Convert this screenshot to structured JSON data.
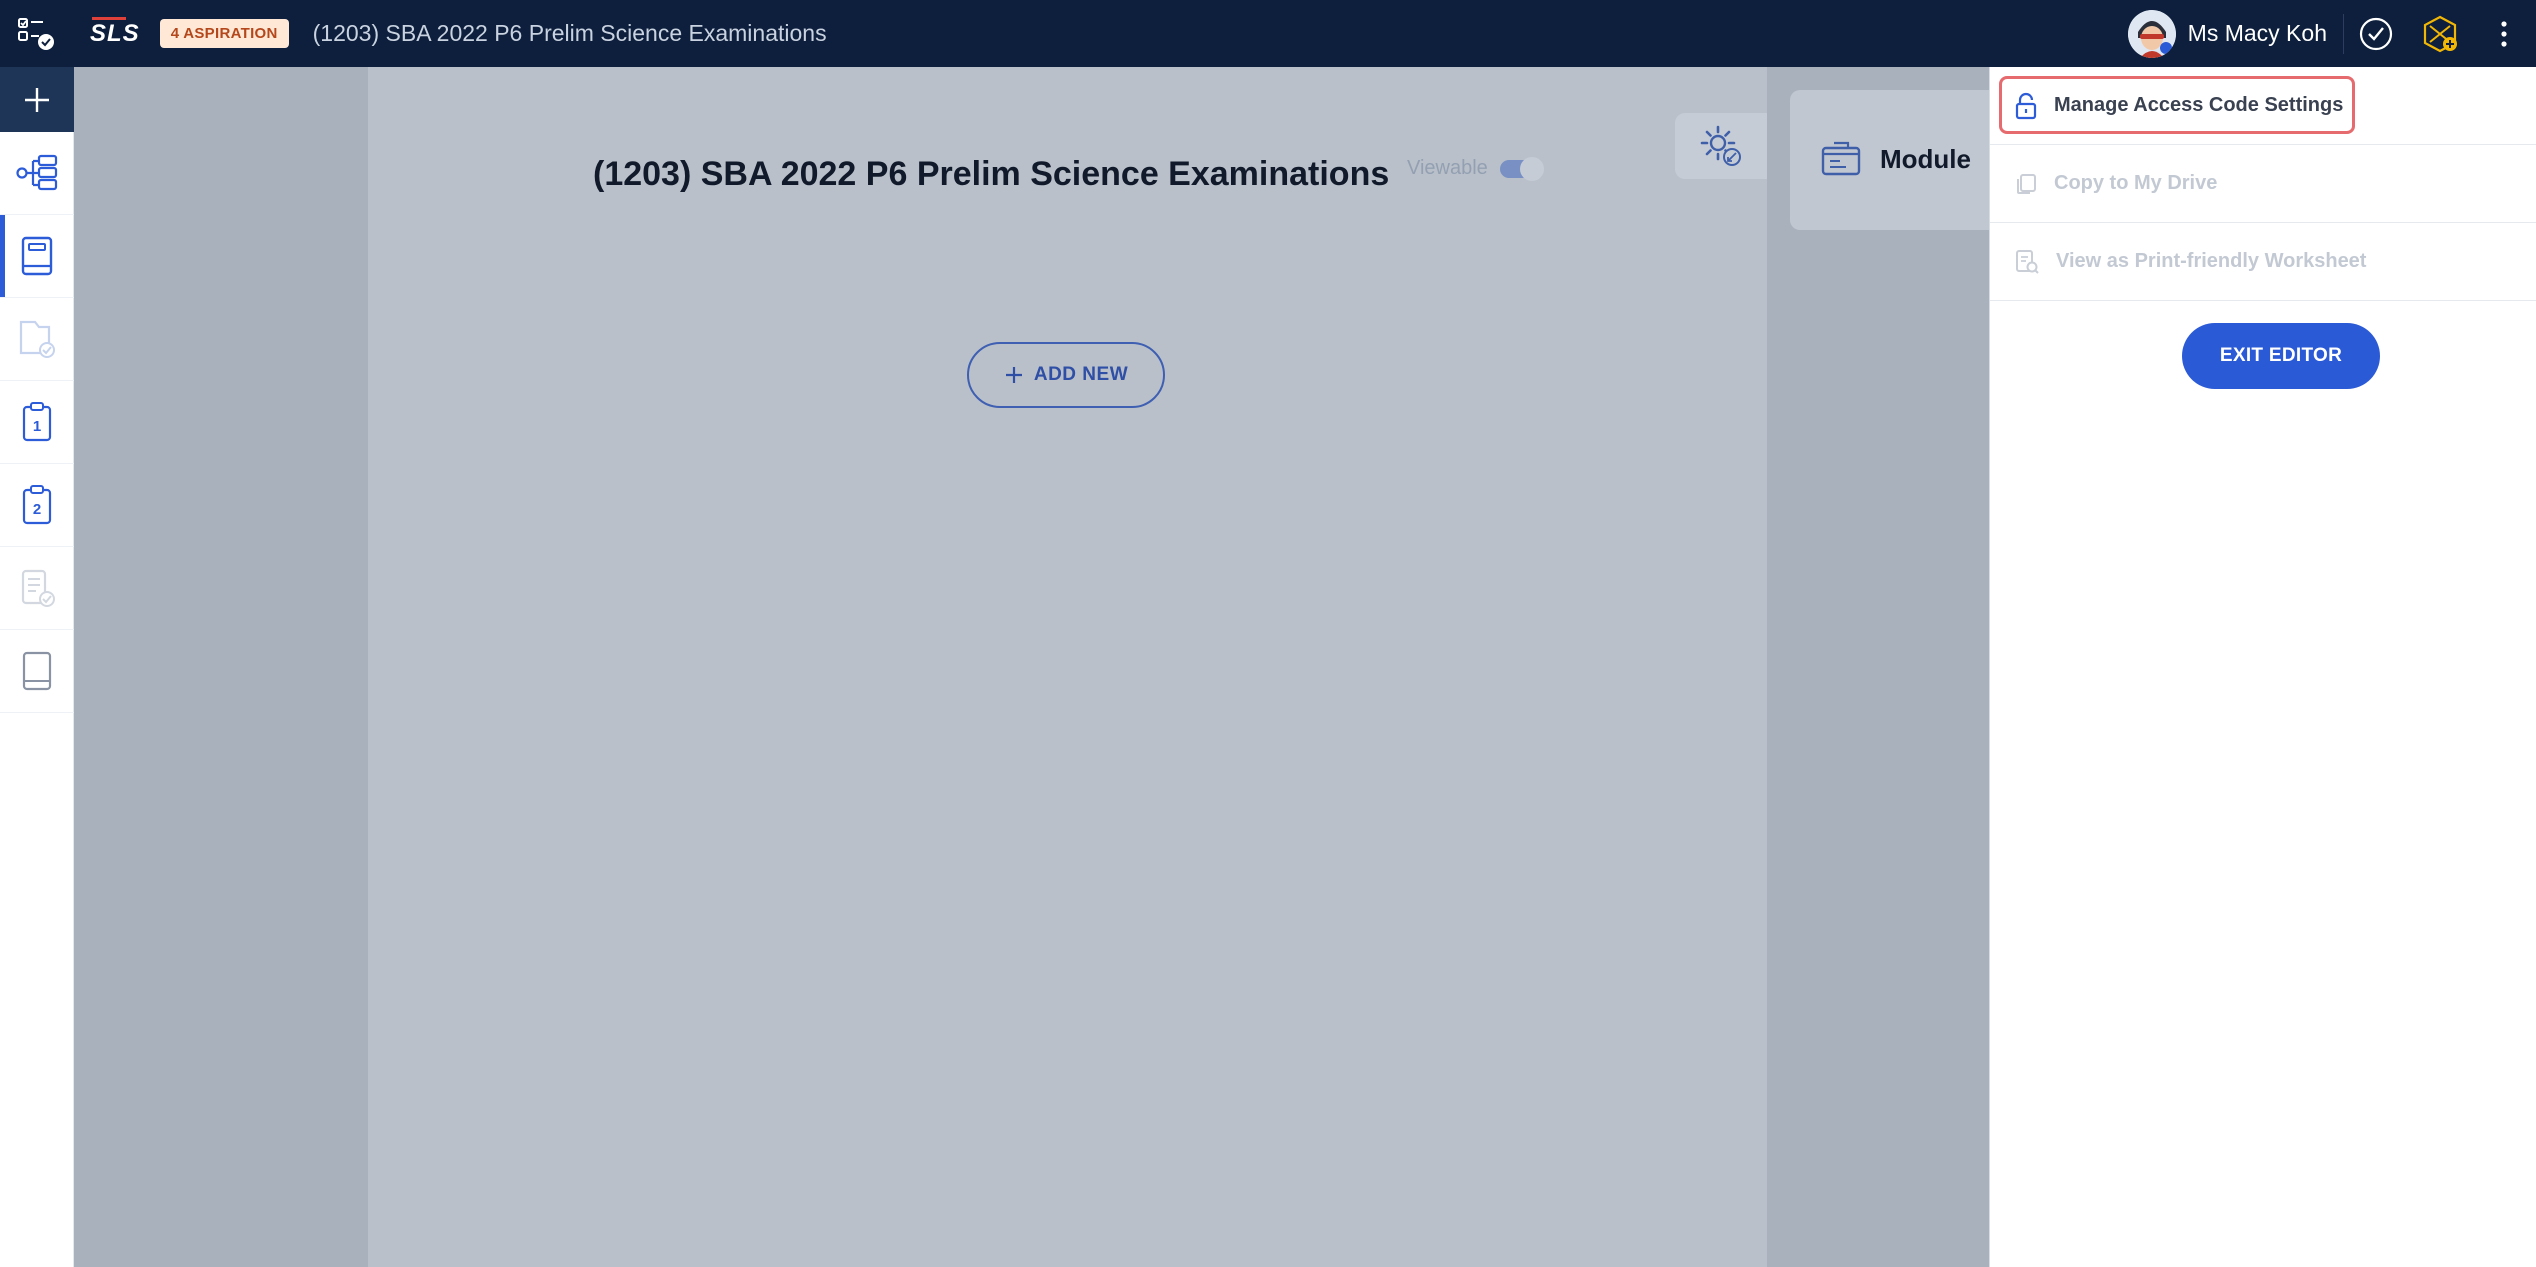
{
  "topbar": {
    "menu_icon": "apps-checklist-icon",
    "logo": "SLS",
    "badge": "4 ASPIRATION",
    "title": "(1203) SBA 2022 P6 Prelim Science Examinations",
    "user_name": "Ms Macy Koh",
    "icons": [
      "check-circle-icon",
      "gamification-badge-icon",
      "more-vertical-icon"
    ]
  },
  "sidebar": {
    "items": [
      {
        "icon": "add-icon"
      },
      {
        "icon": "lesson-map-icon"
      },
      {
        "icon": "book-icon",
        "active": true
      },
      {
        "icon": "folder-check-icon",
        "disabled": true
      },
      {
        "icon": "clipboard-1-icon"
      },
      {
        "icon": "clipboard-2-icon"
      },
      {
        "icon": "document-check-icon",
        "disabled": true
      },
      {
        "icon": "notebook-icon"
      }
    ]
  },
  "main": {
    "page_title": "(1203) SBA 2022 P6 Prelim Science Examinations",
    "viewable_label": "Viewable",
    "viewable_on": true,
    "add_new_label": "ADD NEW",
    "module_label": "Module"
  },
  "menu": {
    "items": [
      {
        "label": "Manage Access Code Settings",
        "icon": "lock-icon",
        "enabled": true,
        "highlighted": true
      },
      {
        "label": "Copy to My Drive",
        "icon": "copy-icon",
        "enabled": false
      },
      {
        "label": "View as Print-friendly Worksheet",
        "icon": "print-preview-icon",
        "enabled": false
      }
    ],
    "exit_label": "EXIT EDITOR"
  },
  "colors": {
    "topbar": "#0d1f3c",
    "accent": "#2b5ad6",
    "highlight": "#e56b6f",
    "badge_bg": "#ffe9d6"
  }
}
